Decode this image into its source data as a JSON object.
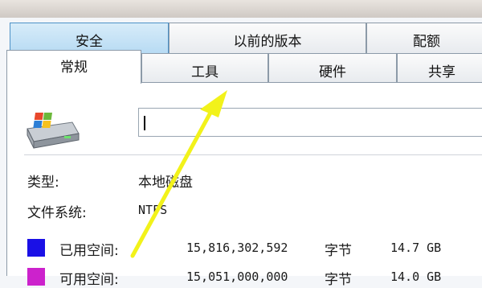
{
  "tabs_row1": [
    {
      "label": "安全"
    },
    {
      "label": "以前的版本"
    },
    {
      "label": "配额"
    }
  ],
  "tabs_row2": [
    {
      "label": "常规"
    },
    {
      "label": "工具"
    },
    {
      "label": "硬件"
    },
    {
      "label": "共享"
    }
  ],
  "general": {
    "name_value": "",
    "type_label": "类型:",
    "type_value": "本地磁盘",
    "fs_label": "文件系统:",
    "fs_value": "NTFS",
    "used_label": "已用空间:",
    "used_bytes": "15,816,302,592",
    "used_unit": "字节",
    "used_size": "14.7 GB",
    "free_label": "可用空间:",
    "free_bytes": "15,051,000,000",
    "free_unit": "字节",
    "free_size": "14.0 GB"
  },
  "colors": {
    "used_swatch": "#1a10e6",
    "free_swatch": "#cc22cc",
    "arrow": "#f2f21a",
    "tab_hover": "#b6daf3"
  },
  "icons": {
    "drive": "hard-drive-windows-icon"
  }
}
